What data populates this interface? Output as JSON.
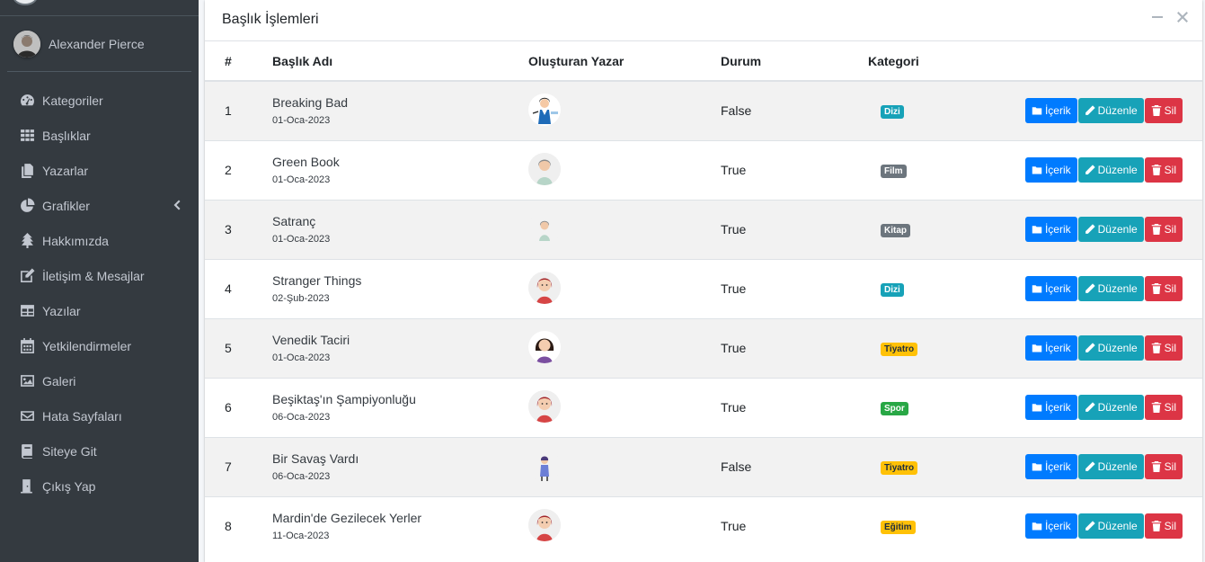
{
  "sidebar": {
    "user_name": "Alexander Pierce",
    "items": [
      {
        "label": "Kategoriler",
        "icon": "tachometer-icon"
      },
      {
        "label": "Başlıklar",
        "icon": "grid-icon"
      },
      {
        "label": "Yazarlar",
        "icon": "copy-icon"
      },
      {
        "label": "Grafikler",
        "icon": "pie-chart-icon",
        "has_submenu": true
      },
      {
        "label": "Hakkımızda",
        "icon": "tree-icon"
      },
      {
        "label": "İletişim & Mesajlar",
        "icon": "edit-icon"
      },
      {
        "label": "Yazılar",
        "icon": "table-icon"
      },
      {
        "label": "Yetkilendirmeler",
        "icon": "calendar-icon"
      },
      {
        "label": "Galeri",
        "icon": "image-icon"
      },
      {
        "label": "Hata Sayfaları",
        "icon": "envelope-icon"
      },
      {
        "label": "Siteye Git",
        "icon": "book-icon"
      },
      {
        "label": "Çıkış Yap",
        "icon": "door-icon"
      }
    ]
  },
  "card": {
    "title": "Başlık İşlemleri",
    "columns": [
      "#",
      "Başlık Adı",
      "Oluşturan Yazar",
      "Durum",
      "Kategori"
    ],
    "buttons": {
      "content": "İçerik",
      "edit": "Düzenle",
      "delete": "Sil"
    },
    "rows": [
      {
        "num": "1",
        "title": "Breaking Bad",
        "date": "01-Oca-2023",
        "status": "False",
        "category": "Dizi",
        "cat_color": "#17a2b8",
        "avatar": "woman-teacher"
      },
      {
        "num": "2",
        "title": "Green Book",
        "date": "01-Oca-2023",
        "status": "True",
        "category": "Film",
        "cat_color": "#6c757d",
        "avatar": "woman-gray"
      },
      {
        "num": "3",
        "title": "Satranç",
        "date": "01-Oca-2023",
        "status": "True",
        "category": "Kitap",
        "cat_color": "#6c757d",
        "avatar": "woman-gray-small"
      },
      {
        "num": "4",
        "title": "Stranger Things",
        "date": "02-Şub-2023",
        "status": "True",
        "category": "Dizi",
        "cat_color": "#17a2b8",
        "avatar": "woman-red"
      },
      {
        "num": "5",
        "title": "Venedik Taciri",
        "date": "01-Oca-2023",
        "status": "True",
        "category": "Tiyatro",
        "cat_color": "#ffc107",
        "avatar": "woman-dark"
      },
      {
        "num": "6",
        "title": "Beşiktaş'ın Şampiyonluğu",
        "date": "06-Oca-2023",
        "status": "True",
        "category": "Spor",
        "cat_color": "#28a745",
        "avatar": "woman-red"
      },
      {
        "num": "7",
        "title": "Bir Savaş Vardı",
        "date": "06-Oca-2023",
        "status": "False",
        "category": "Tiyatro",
        "cat_color": "#ffc107",
        "avatar": "woman-blue"
      },
      {
        "num": "8",
        "title": "Mardin'de Gezilecek Yerler",
        "date": "11-Oca-2023",
        "status": "True",
        "category": "Eğitim",
        "cat_color": "#ffc107",
        "avatar": "woman-red"
      }
    ]
  }
}
